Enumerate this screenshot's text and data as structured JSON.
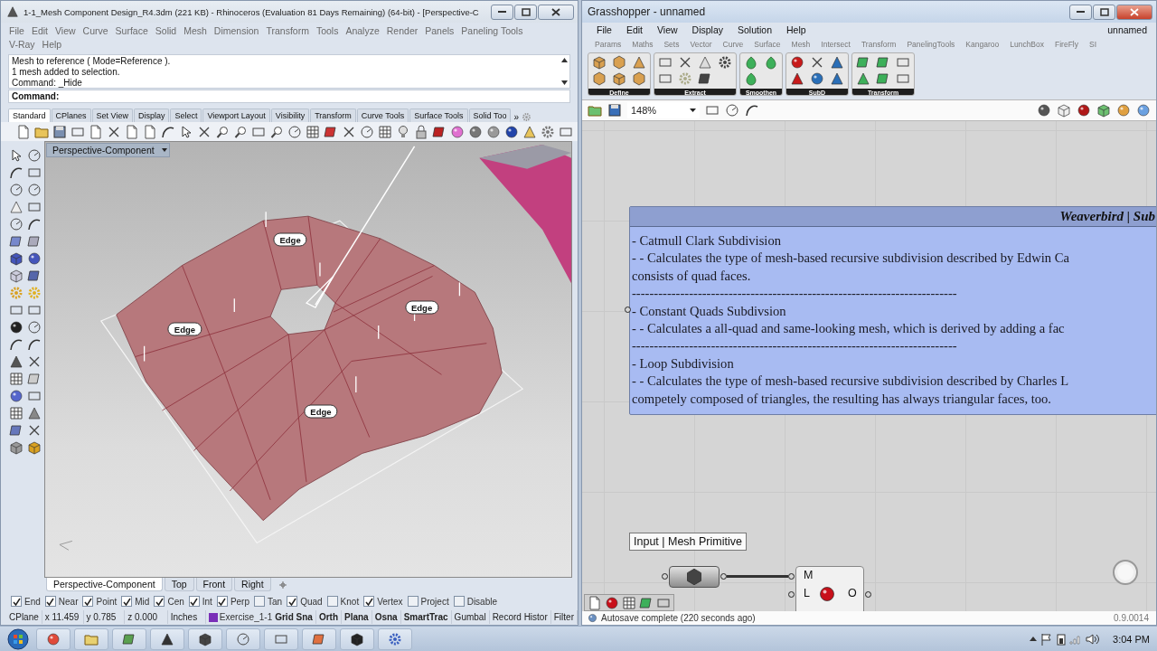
{
  "rhino": {
    "active": false,
    "title": "1-1_Mesh Component Design_R4.3dm (221 KB) - Rhinoceros (Evaluation 81 Days Remaining) (64-bit) - [Perspective-C",
    "menu": [
      "File",
      "Edit",
      "View",
      "Curve",
      "Surface",
      "Solid",
      "Mesh",
      "Dimension",
      "Transform",
      "Tools",
      "Analyze",
      "Render",
      "Panels",
      "Paneling Tools",
      "V-Ray",
      "Help"
    ],
    "command_history": [
      "Mesh to reference ( Mode=Reference ).",
      "1 mesh added to selection.",
      "Command: _Hide"
    ],
    "command_prompt": "Command:",
    "toolbar_tabs": [
      {
        "label": "Standard",
        "selected": true
      },
      {
        "label": "CPlanes",
        "selected": false
      },
      {
        "label": "Set View",
        "selected": false
      },
      {
        "label": "Display",
        "selected": false
      },
      {
        "label": "Select",
        "selected": false
      },
      {
        "label": "Viewport Layout",
        "selected": false
      },
      {
        "label": "Visibility",
        "selected": false
      },
      {
        "label": "Transform",
        "selected": false
      },
      {
        "label": "Curve Tools",
        "selected": false
      },
      {
        "label": "Surface Tools",
        "selected": false
      },
      {
        "label": "Solid Too",
        "selected": false
      }
    ],
    "toolbar_more": "»",
    "viewport": {
      "title": "Perspective-Component",
      "labels": [
        "Edge",
        "Edge",
        "Edge",
        "Edge"
      ]
    },
    "viewport_tabs": [
      {
        "label": "Perspective-Component",
        "selected": true
      },
      {
        "label": "Top",
        "selected": false
      },
      {
        "label": "Front",
        "selected": false
      },
      {
        "label": "Right",
        "selected": false
      }
    ],
    "osnaps": [
      {
        "label": "End",
        "checked": true
      },
      {
        "label": "Near",
        "checked": true
      },
      {
        "label": "Point",
        "checked": true
      },
      {
        "label": "Mid",
        "checked": true
      },
      {
        "label": "Cen",
        "checked": true
      },
      {
        "label": "Int",
        "checked": true
      },
      {
        "label": "Perp",
        "checked": true
      },
      {
        "label": "Tan",
        "checked": false
      },
      {
        "label": "Quad",
        "checked": true
      },
      {
        "label": "Knot",
        "checked": false
      },
      {
        "label": "Vertex",
        "checked": true
      },
      {
        "label": "Project",
        "checked": false
      },
      {
        "label": "Disable",
        "checked": false
      }
    ],
    "status": {
      "cplane": "CPlane",
      "x": "x 11.459",
      "y": "y 0.785",
      "z": "z 0.000",
      "units": "Inches",
      "layer": {
        "name": "Exercise_1-1",
        "color": "#7a2fb8"
      },
      "toggles": [
        {
          "label": "Grid Sna",
          "on": true
        },
        {
          "label": "Orth",
          "on": true
        },
        {
          "label": "Plana",
          "on": true
        },
        {
          "label": "Osna",
          "on": true
        },
        {
          "label": "SmartTrac",
          "on": true
        },
        {
          "label": "Gumbal",
          "on": false
        },
        {
          "label": "Record Histor",
          "on": false
        },
        {
          "label": "Filter",
          "on": false
        }
      ]
    }
  },
  "grasshopper": {
    "active": true,
    "title": "Grasshopper - unnamed",
    "menu": [
      "File",
      "Edit",
      "View",
      "Display",
      "Solution",
      "Help"
    ],
    "document": "unnamed",
    "tabs": [
      "Params",
      "Maths",
      "Sets",
      "Vector",
      "Curve",
      "Surface",
      "Mesh",
      "Intersect",
      "Transform",
      "PanelingTools",
      "Kangaroo",
      "LunchBox",
      "FireFly",
      "SI"
    ],
    "ribbon_groups": [
      "Define",
      "Extract",
      "Smoothen",
      "SubD",
      "Transform"
    ],
    "zoom": "148%",
    "panel": {
      "title": "Weaverbird | Sub",
      "lines": [
        "- Catmull Clark Subdivision",
        "- - Calculates the type of mesh-based recursive subdivision described by Edwin Ca",
        "consists of quad faces.",
        "--------------------------------------------------------------------------",
        "- Constant Quads Subdivsion",
        "- - Calculates a all-quad and same-looking mesh, which is derived by adding a fac",
        "--------------------------------------------------------------------------",
        "- Loop Subdivision",
        "- - Calculates the type of mesh-based recursive subdivision described by Charles L",
        "competely composed of triangles, the resulting has always triangular faces, too."
      ]
    },
    "tooltip": "Input | Mesh Primitive",
    "component": {
      "inputs": [
        "M",
        "L"
      ],
      "outputs": [
        "O"
      ]
    },
    "status": "Autosave complete (220 seconds ago)",
    "version": "0.9.0014"
  },
  "taskbar": {
    "clock": "3:04 PM"
  }
}
